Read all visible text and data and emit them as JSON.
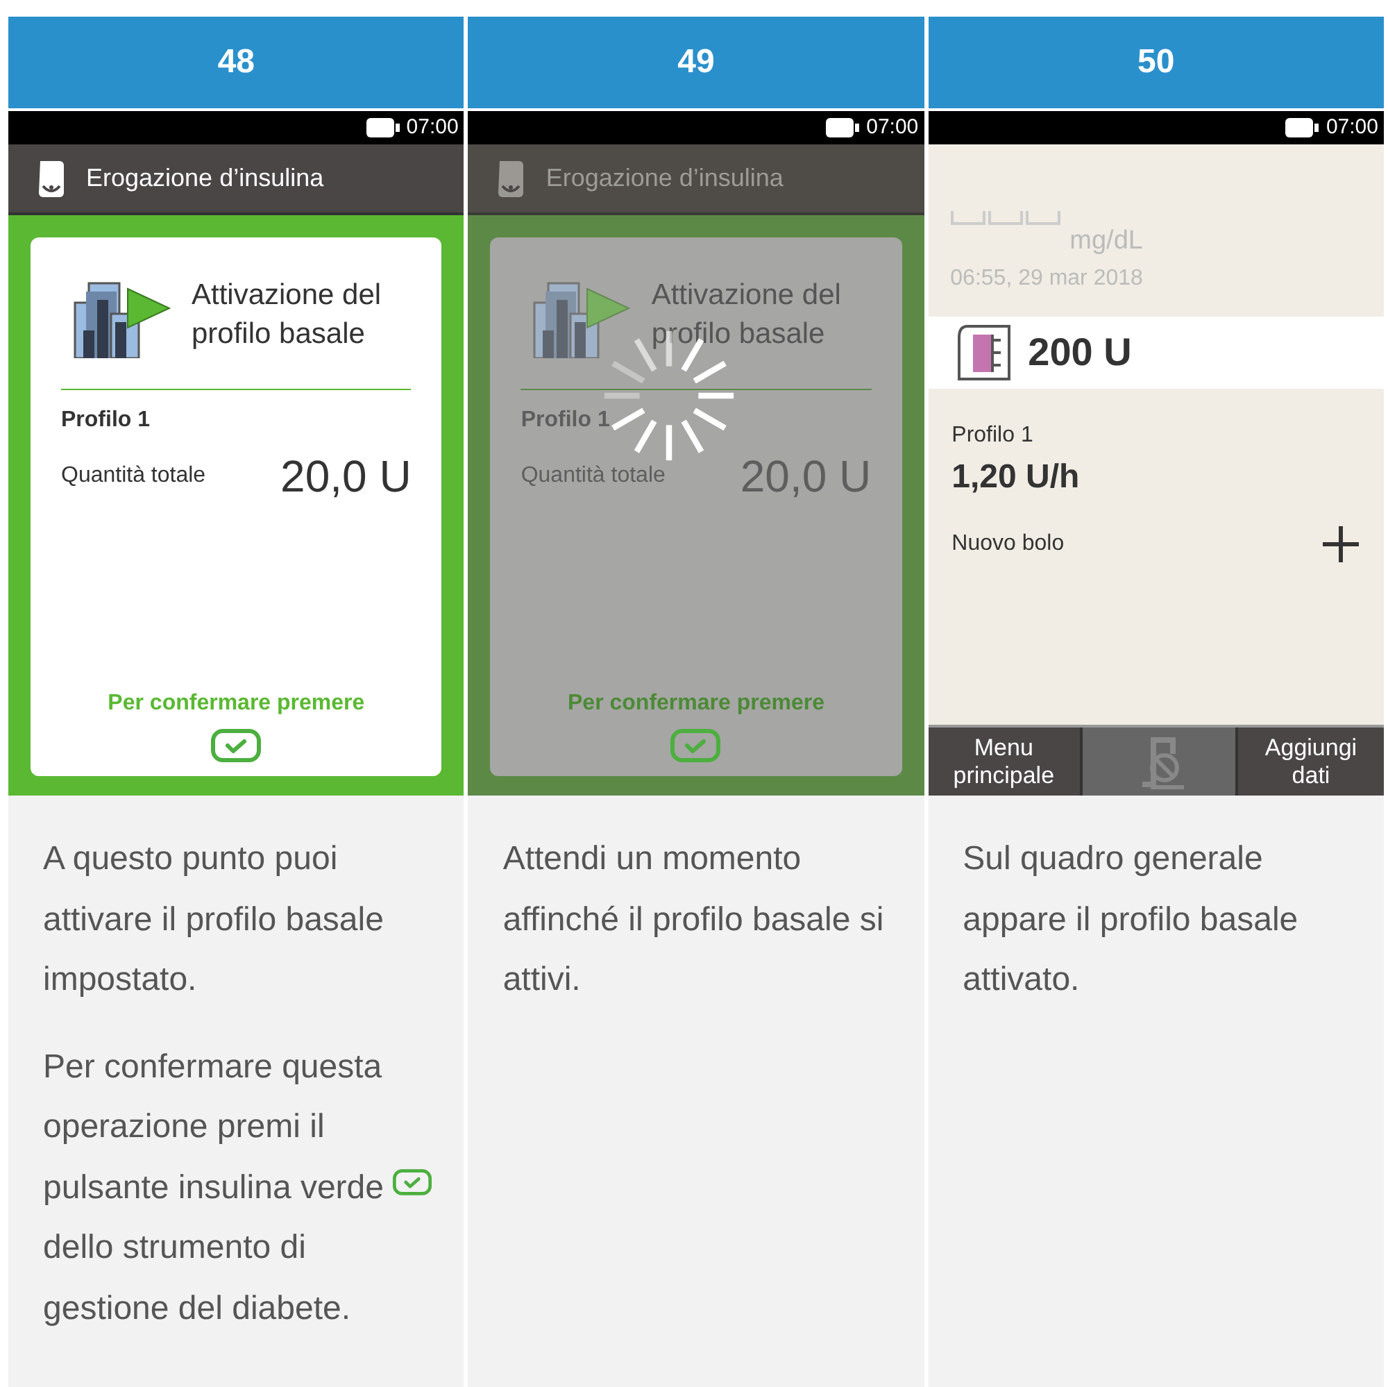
{
  "steps": [
    {
      "number": "48",
      "screen": {
        "kind": "confirm",
        "busy": false,
        "status_time": "07:00",
        "header_title": "Erogazione d’insulina",
        "card_title": "Attivazione del profilo basale",
        "profile": "Profilo 1",
        "total_label": "Quantità totale",
        "total_value": "20,0 U",
        "prompt": "Per confermare premere"
      },
      "paragraphs": [
        {
          "before": "A questo punto puoi attivare il profilo basale impostato."
        },
        {
          "before": "Per confermare questa operazione premi il pulsante insulina verde",
          "kind": "with_icon",
          "after": "dello strumento di gestione del diabete."
        }
      ]
    },
    {
      "number": "49",
      "screen": {
        "kind": "confirm",
        "busy": true,
        "status_time": "07:00",
        "header_title": "Erogazione d’insulina",
        "card_title": "Attivazione del profilo basale",
        "profile": "Profilo 1",
        "total_label": "Quantità totale",
        "total_value": "20,0 U",
        "prompt": "Per confermare premere"
      },
      "paragraphs": [
        {
          "before": "Attendi un momento affinché il profilo basale si attivi."
        }
      ]
    },
    {
      "number": "50",
      "screen": {
        "kind": "home",
        "status_time": "07:00",
        "glucose_unit": "mg/dL",
        "glucose_time": "06:55, 29 mar 2018",
        "reservoir": "200 U",
        "profile": "Profilo 1",
        "rate": "1,20 U/h",
        "bolus_label": "Nuovo bolo",
        "buttons": [
          "Menu principale",
          "Aggiungi dati"
        ]
      },
      "paragraphs": [
        {
          "before": "Sul quadro generale appare il profilo basale attivato."
        }
      ]
    }
  ]
}
